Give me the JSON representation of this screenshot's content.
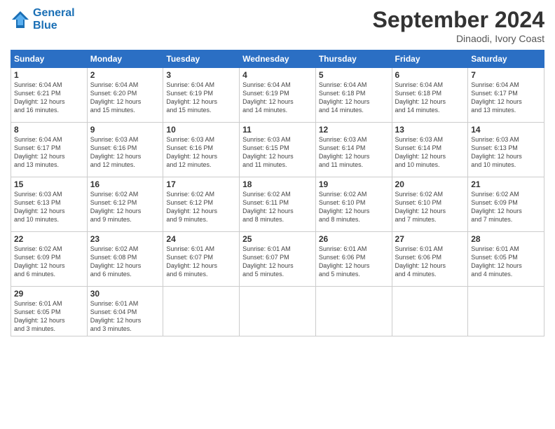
{
  "logo": {
    "line1": "General",
    "line2": "Blue"
  },
  "title": "September 2024",
  "subtitle": "Dinaodi, Ivory Coast",
  "weekdays": [
    "Sunday",
    "Monday",
    "Tuesday",
    "Wednesday",
    "Thursday",
    "Friday",
    "Saturday"
  ],
  "days": [
    {
      "num": "",
      "info": ""
    },
    {
      "num": "",
      "info": ""
    },
    {
      "num": "",
      "info": ""
    },
    {
      "num": "",
      "info": ""
    },
    {
      "num": "",
      "info": ""
    },
    {
      "num": "",
      "info": ""
    },
    {
      "num": "7",
      "info": "Sunrise: 6:04 AM\nSunset: 6:17 PM\nDaylight: 12 hours\nand 13 minutes."
    },
    {
      "num": "1",
      "info": "Sunrise: 6:04 AM\nSunset: 6:21 PM\nDaylight: 12 hours\nand 16 minutes."
    },
    {
      "num": "2",
      "info": "Sunrise: 6:04 AM\nSunset: 6:20 PM\nDaylight: 12 hours\nand 15 minutes."
    },
    {
      "num": "3",
      "info": "Sunrise: 6:04 AM\nSunset: 6:19 PM\nDaylight: 12 hours\nand 15 minutes."
    },
    {
      "num": "4",
      "info": "Sunrise: 6:04 AM\nSunset: 6:19 PM\nDaylight: 12 hours\nand 14 minutes."
    },
    {
      "num": "5",
      "info": "Sunrise: 6:04 AM\nSunset: 6:18 PM\nDaylight: 12 hours\nand 14 minutes."
    },
    {
      "num": "6",
      "info": "Sunrise: 6:04 AM\nSunset: 6:18 PM\nDaylight: 12 hours\nand 14 minutes."
    },
    {
      "num": "8",
      "info": "Sunrise: 6:04 AM\nSunset: 6:17 PM\nDaylight: 12 hours\nand 13 minutes."
    },
    {
      "num": "9",
      "info": "Sunrise: 6:03 AM\nSunset: 6:16 PM\nDaylight: 12 hours\nand 12 minutes."
    },
    {
      "num": "10",
      "info": "Sunrise: 6:03 AM\nSunset: 6:16 PM\nDaylight: 12 hours\nand 12 minutes."
    },
    {
      "num": "11",
      "info": "Sunrise: 6:03 AM\nSunset: 6:15 PM\nDaylight: 12 hours\nand 11 minutes."
    },
    {
      "num": "12",
      "info": "Sunrise: 6:03 AM\nSunset: 6:14 PM\nDaylight: 12 hours\nand 11 minutes."
    },
    {
      "num": "13",
      "info": "Sunrise: 6:03 AM\nSunset: 6:14 PM\nDaylight: 12 hours\nand 10 minutes."
    },
    {
      "num": "14",
      "info": "Sunrise: 6:03 AM\nSunset: 6:13 PM\nDaylight: 12 hours\nand 10 minutes."
    },
    {
      "num": "15",
      "info": "Sunrise: 6:03 AM\nSunset: 6:13 PM\nDaylight: 12 hours\nand 10 minutes."
    },
    {
      "num": "16",
      "info": "Sunrise: 6:02 AM\nSunset: 6:12 PM\nDaylight: 12 hours\nand 9 minutes."
    },
    {
      "num": "17",
      "info": "Sunrise: 6:02 AM\nSunset: 6:12 PM\nDaylight: 12 hours\nand 9 minutes."
    },
    {
      "num": "18",
      "info": "Sunrise: 6:02 AM\nSunset: 6:11 PM\nDaylight: 12 hours\nand 8 minutes."
    },
    {
      "num": "19",
      "info": "Sunrise: 6:02 AM\nSunset: 6:10 PM\nDaylight: 12 hours\nand 8 minutes."
    },
    {
      "num": "20",
      "info": "Sunrise: 6:02 AM\nSunset: 6:10 PM\nDaylight: 12 hours\nand 7 minutes."
    },
    {
      "num": "21",
      "info": "Sunrise: 6:02 AM\nSunset: 6:09 PM\nDaylight: 12 hours\nand 7 minutes."
    },
    {
      "num": "22",
      "info": "Sunrise: 6:02 AM\nSunset: 6:09 PM\nDaylight: 12 hours\nand 6 minutes."
    },
    {
      "num": "23",
      "info": "Sunrise: 6:02 AM\nSunset: 6:08 PM\nDaylight: 12 hours\nand 6 minutes."
    },
    {
      "num": "24",
      "info": "Sunrise: 6:01 AM\nSunset: 6:07 PM\nDaylight: 12 hours\nand 6 minutes."
    },
    {
      "num": "25",
      "info": "Sunrise: 6:01 AM\nSunset: 6:07 PM\nDaylight: 12 hours\nand 5 minutes."
    },
    {
      "num": "26",
      "info": "Sunrise: 6:01 AM\nSunset: 6:06 PM\nDaylight: 12 hours\nand 5 minutes."
    },
    {
      "num": "27",
      "info": "Sunrise: 6:01 AM\nSunset: 6:06 PM\nDaylight: 12 hours\nand 4 minutes."
    },
    {
      "num": "28",
      "info": "Sunrise: 6:01 AM\nSunset: 6:05 PM\nDaylight: 12 hours\nand 4 minutes."
    },
    {
      "num": "29",
      "info": "Sunrise: 6:01 AM\nSunset: 6:05 PM\nDaylight: 12 hours\nand 3 minutes."
    },
    {
      "num": "30",
      "info": "Sunrise: 6:01 AM\nSunset: 6:04 PM\nDaylight: 12 hours\nand 3 minutes."
    },
    {
      "num": "",
      "info": ""
    },
    {
      "num": "",
      "info": ""
    },
    {
      "num": "",
      "info": ""
    },
    {
      "num": "",
      "info": ""
    },
    {
      "num": "",
      "info": ""
    }
  ]
}
